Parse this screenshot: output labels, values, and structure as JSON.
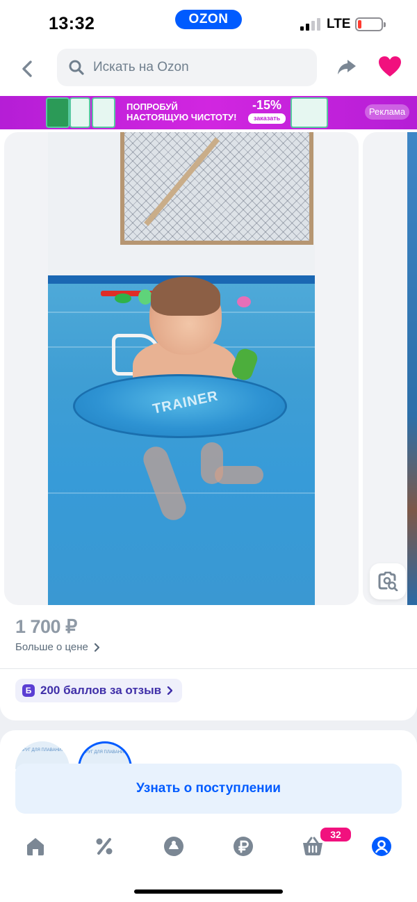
{
  "status_bar": {
    "time": "13:32",
    "center_logo": "OZON",
    "network": "LTE",
    "battery_level": 0.15,
    "battery_color": "#ff3b30"
  },
  "search": {
    "placeholder": "Искать на Ozon"
  },
  "icons": {
    "back": "chevron-left-icon",
    "search": "search-icon",
    "share": "share-arrow-icon",
    "favorite": "heart-icon",
    "image_search": "photo-search-icon",
    "nav_home": "home-icon",
    "nav_promo": "percent-icon",
    "nav_fresh": "fresh-icon",
    "nav_finance": "ruble-icon",
    "nav_cart": "cart-icon",
    "nav_profile": "profile-icon"
  },
  "ad_banner": {
    "line1": "ПОПРОБУЙ",
    "line2": "НАСТОЯЩУЮ ЧИСТОТУ!",
    "discount": "-15%",
    "order": "заказать",
    "ad_label": "Реклама"
  },
  "product": {
    "price": "1 700 ₽",
    "more_about_price": "Больше о цене",
    "points_badge": "Б",
    "points_text": "200 баллов за отзыв",
    "ring_print": "TRAINER"
  },
  "variants": [
    {
      "label": "КРУГ ДЛЯ ПЛАВАНИЯ",
      "selected": false
    },
    {
      "label": "КРУГ ДЛЯ ПЛАВАНИЯ",
      "selected": true
    }
  ],
  "notify_button": {
    "label": "Узнать о поступлении"
  },
  "bottom_nav": {
    "cart_count": "32",
    "active_item": "profile"
  },
  "colors": {
    "accent": "#005bff",
    "favorite": "#f1117e",
    "ad_bg": "#c020d8"
  }
}
